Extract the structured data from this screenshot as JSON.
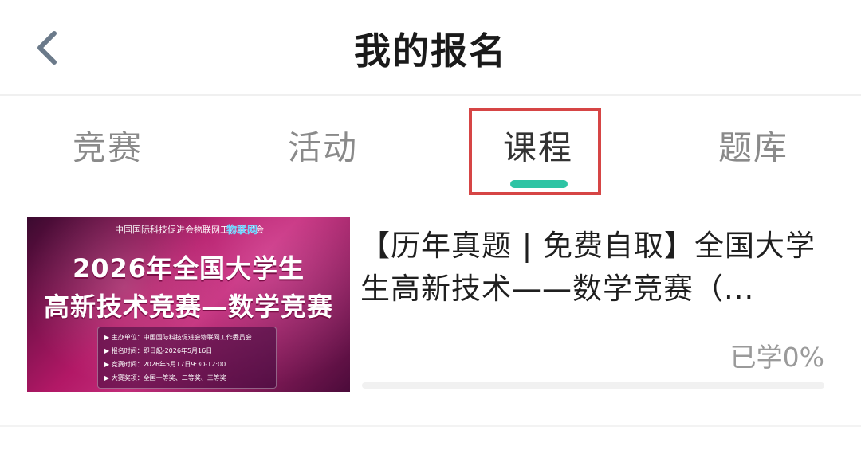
{
  "header": {
    "title": "我的报名",
    "back_icon": "chevron-left-icon"
  },
  "tabs": [
    {
      "label": "竞赛",
      "active": false
    },
    {
      "label": "活动",
      "active": false
    },
    {
      "label": "课程",
      "active": true
    },
    {
      "label": "题库",
      "active": false
    }
  ],
  "colors": {
    "accent": "#2ec4a4",
    "highlight_box": "#d64545"
  },
  "course": {
    "title": "【历年真题 | 免费自取】全国大学生高新技术——数学竞赛（...",
    "progress_label": "已学0%",
    "progress": 0,
    "thumbnail": {
      "org": "中国国际科技促进会物联网工作委员会",
      "badge": "物联网",
      "line1": "2026年全国大学生",
      "line2": "高新技术竞赛—数学竞赛",
      "info": [
        "▶ 主办单位：中国国际科技促进会物联网工作委员会",
        "▶ 报名时间：即日起-2026年5月16日",
        "▶ 竞赛时间：2026年5月17日9:30-12:00",
        "▶ 大赛奖项：全国一等奖、二等奖、三等奖"
      ]
    }
  }
}
